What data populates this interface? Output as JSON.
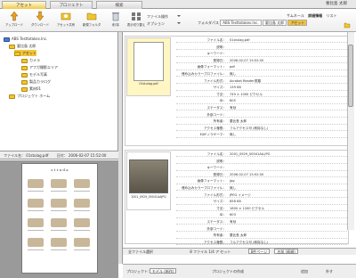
{
  "tabs": [
    "アセット",
    "プロジェクト",
    "検索"
  ],
  "user": "要比島 太郎",
  "toolbar": [
    {
      "label": "アップロード",
      "icon": "upload-icon"
    },
    {
      "label": "ダウンロード",
      "icon": "download-icon"
    },
    {
      "label": "アセット共有",
      "icon": "share-icon"
    },
    {
      "label": "新規フォルダ",
      "icon": "new-folder-icon"
    },
    {
      "label": "削 除",
      "icon": "trash-icon"
    },
    {
      "label": "表示切り替え",
      "icon": "view-switch-icon"
    }
  ],
  "fileop": {
    "file_op": "ファイル操作",
    "options": "オプション"
  },
  "folderpath": {
    "label": "フォルダパス",
    "crumbs": [
      "ABS Testtotakes.Inc.",
      "要比島 太郎",
      "アセット"
    ]
  },
  "viewtabs": [
    "サムネール",
    "詳細情報",
    "リスト"
  ],
  "tree": [
    {
      "label": "ABS Testtotakes.Inc.",
      "indent": 0,
      "blue": true
    },
    {
      "label": "要比島 太郎",
      "indent": 1,
      "blue": false
    },
    {
      "label": "アセット",
      "indent": 2,
      "blue": false,
      "selected": true
    },
    {
      "label": "カメラ",
      "indent": 3,
      "blue": false
    },
    {
      "label": "アフガ撮影エリア",
      "indent": 3,
      "blue": false
    },
    {
      "label": "モデル写真",
      "indent": 3,
      "blue": false
    },
    {
      "label": "製品カラログ",
      "indent": 3,
      "blue": false
    },
    {
      "label": "素材01",
      "indent": 3,
      "blue": false
    },
    {
      "label": "プロジェクト ホーム",
      "indent": 1,
      "blue": false
    }
  ],
  "fileinfo": {
    "name_label": "ファイル名：",
    "name": "01stulag.pdf",
    "date_label": "日付：",
    "date": "2006-02-07 15:52:00"
  },
  "preview_title": "s t r a d a",
  "items": [
    {
      "thumb": "01stulag.pdf",
      "rows": [
        [
          "ファイル名：",
          "01stulag.pdf"
        ],
        [
          "説明：",
          ""
        ],
        [
          "キーワード：",
          ""
        ],
        [
          "登録日：",
          "2006-02-07 15:52:00"
        ],
        [
          "画像フォーマット：",
          "pdf"
        ],
        [
          "埋め込みカラープロファイル：",
          "無し"
        ],
        [
          "ファイル形式：",
          "Acrobat Reader書類"
        ],
        [
          "サイズ：",
          "139 KB"
        ],
        [
          "寸法：",
          "749 × 1000 ピクセル"
        ],
        [
          "ID：",
          "605"
        ],
        [
          "ステータス：",
          "有効"
        ],
        [
          "外部コード：",
          ""
        ],
        [
          "所有者：",
          "要比島 太郎"
        ],
        [
          "アクセス権限：",
          "フルアクセス可 (削除なし)"
        ],
        [
          "EXIFノラゲーマ：",
          "無し"
        ]
      ]
    },
    {
      "thumb": "2001_0929_00041AAJPG",
      "rows": [
        [
          "ファイル名：",
          "2001_0929_00041AA.JPG"
        ],
        [
          "説明：",
          ""
        ],
        [
          "キーワード：",
          ""
        ],
        [
          "登録日：",
          "2006-02-07 15:52:00"
        ],
        [
          "画像フォーマット：",
          "jpg"
        ],
        [
          "埋め込みカラープロファイル：",
          "無し"
        ],
        [
          "ファイル形式：",
          "JPEG イメージ"
        ],
        [
          "サイズ：",
          "658 KB"
        ],
        [
          "寸法：",
          "1600 × 1200 ピクセル"
        ],
        [
          "ID：",
          "603"
        ],
        [
          "ステータス：",
          "有効"
        ],
        [
          "外部コード：",
          ""
        ],
        [
          "所有者：",
          "要比島 太郎"
        ],
        [
          "アクセス権限：",
          "フルアクセス可 (削除なし)"
        ]
      ]
    }
  ],
  "bottombar": {
    "select_all": "全ファイル選択",
    "count": "8 ファイル 1/4 ア セット",
    "per_page": "8件ページ",
    "sort": "名前 (昇順)"
  },
  "projbar": {
    "label": "プロジェクト：",
    "select": "モデル (新作)",
    "create": "プロジェクトの作成",
    "add": "追加",
    "remove": "外す"
  },
  "colors": {
    "accent": "#f1c94a",
    "selected": "#f3c43a"
  }
}
